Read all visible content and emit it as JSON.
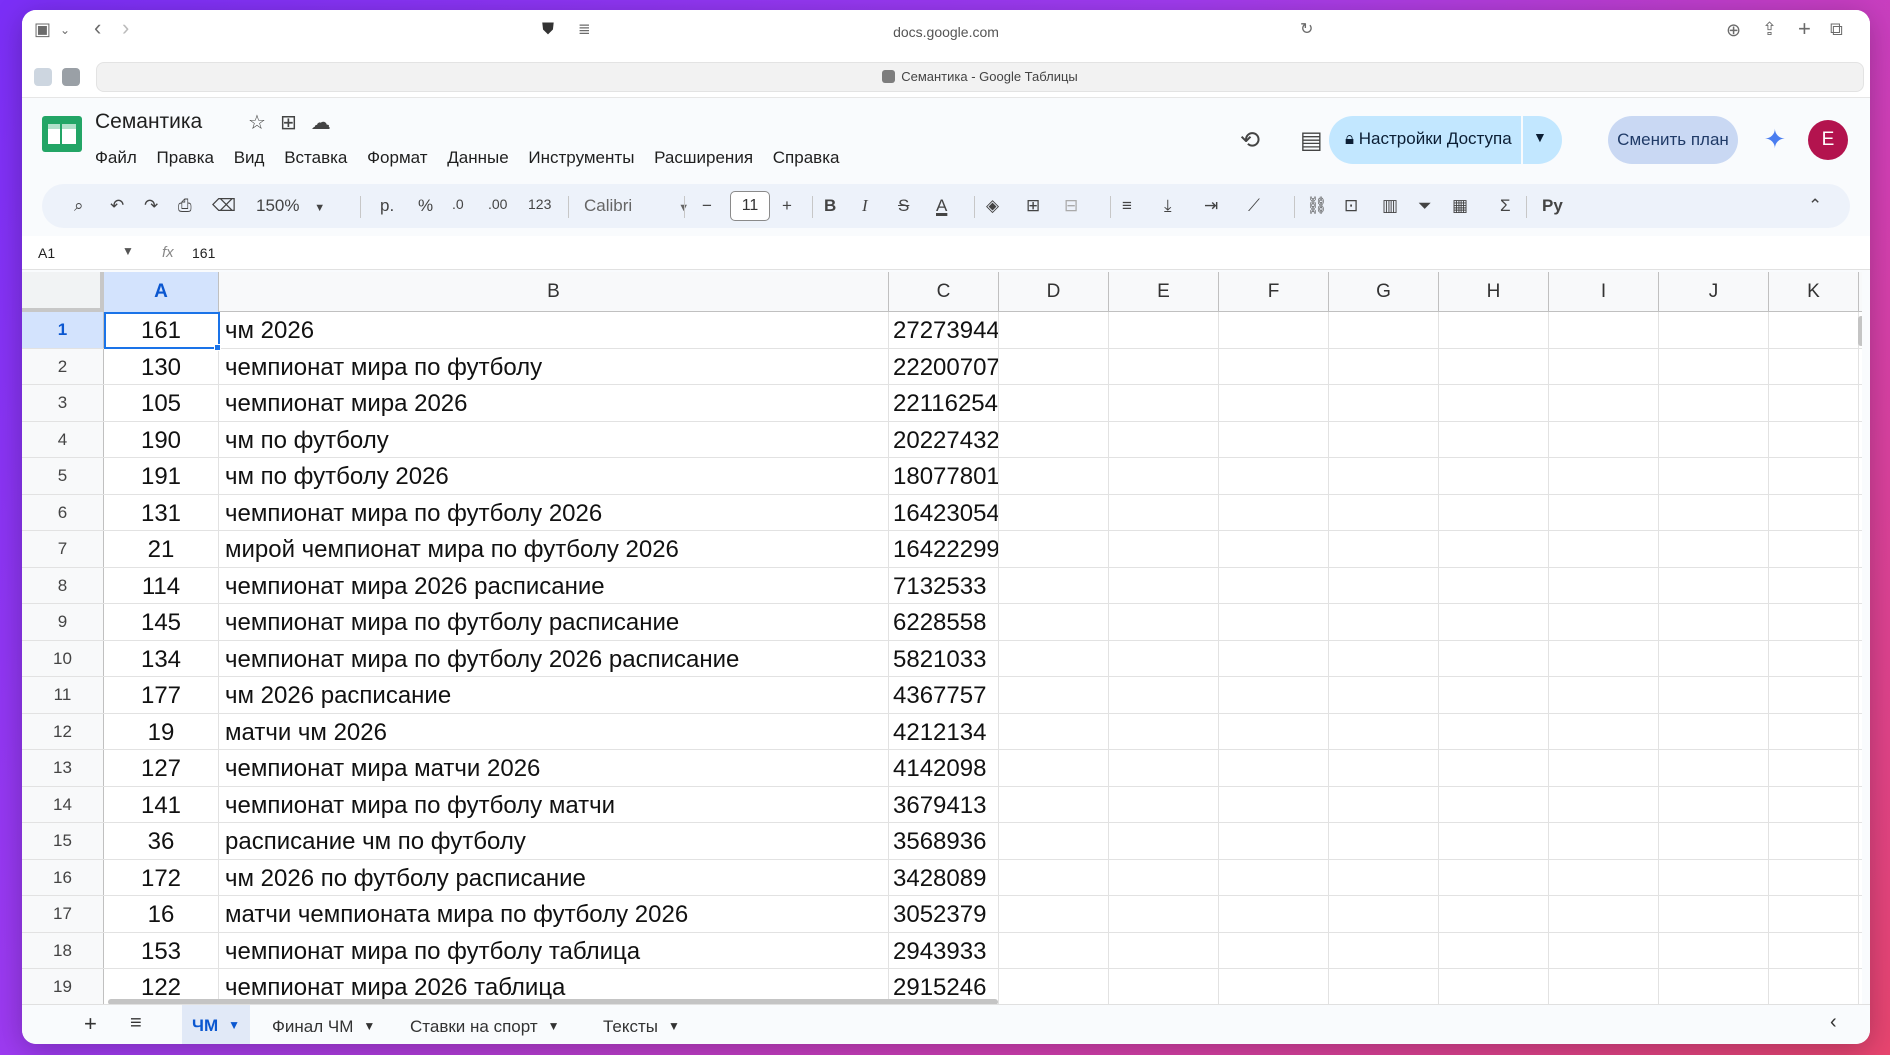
{
  "browser": {
    "url": "docs.google.com",
    "tab_title": "Семантика - Google Таблицы"
  },
  "doc": {
    "title": "Семантика",
    "menu": [
      "Файл",
      "Правка",
      "Вид",
      "Вставка",
      "Формат",
      "Данные",
      "Инструменты",
      "Расширения",
      "Справка"
    ],
    "share_label": "Настройки Доступа",
    "plan_label": "Сменить план",
    "avatar_letter": "E"
  },
  "toolbar": {
    "zoom": "150%",
    "currency": "р.",
    "percent": "%",
    "dec_decrease": ".0",
    "dec_increase": ".00",
    "format_123": "123",
    "font": "Calibri",
    "font_size": "11"
  },
  "formula_bar": {
    "cell_ref": "A1",
    "fx": "fx",
    "value": "161"
  },
  "columns": [
    "A",
    "B",
    "C",
    "D",
    "E",
    "F",
    "G",
    "H",
    "I",
    "J",
    "K"
  ],
  "rows": [
    {
      "n": "1",
      "a": "161",
      "b": "чм 2026",
      "c": "27273944"
    },
    {
      "n": "2",
      "a": "130",
      "b": "чемпионат мира по футболу",
      "c": "22200707"
    },
    {
      "n": "3",
      "a": "105",
      "b": "чемпионат мира 2026",
      "c": "22116254"
    },
    {
      "n": "4",
      "a": "190",
      "b": "чм по футболу",
      "c": "20227432"
    },
    {
      "n": "5",
      "a": "191",
      "b": "чм по футболу 2026",
      "c": "18077801"
    },
    {
      "n": "6",
      "a": "131",
      "b": "чемпионат мира по футболу 2026",
      "c": "16423054"
    },
    {
      "n": "7",
      "a": "21",
      "b": "мирой чемпионат мира по футболу 2026",
      "c": "16422299"
    },
    {
      "n": "8",
      "a": "114",
      "b": "чемпионат мира 2026 расписание",
      "c": "7132533"
    },
    {
      "n": "9",
      "a": "145",
      "b": "чемпионат мира по футболу расписание",
      "c": "6228558"
    },
    {
      "n": "10",
      "a": "134",
      "b": "чемпионат мира по футболу 2026 расписание",
      "c": "5821033"
    },
    {
      "n": "11",
      "a": "177",
      "b": "чм 2026 расписание",
      "c": "4367757"
    },
    {
      "n": "12",
      "a": "19",
      "b": "матчи чм 2026",
      "c": "4212134"
    },
    {
      "n": "13",
      "a": "127",
      "b": "чемпионат мира матчи 2026",
      "c": "4142098"
    },
    {
      "n": "14",
      "a": "141",
      "b": "чемпионат мира по футболу матчи",
      "c": "3679413"
    },
    {
      "n": "15",
      "a": "36",
      "b": "расписание чм по футболу",
      "c": "3568936"
    },
    {
      "n": "16",
      "a": "172",
      "b": "чм 2026 по футболу расписание",
      "c": "3428089"
    },
    {
      "n": "17",
      "a": "16",
      "b": "матчи чемпионата мира по футболу 2026",
      "c": "3052379"
    },
    {
      "n": "18",
      "a": "153",
      "b": "чемпионат мира по футболу таблица",
      "c": "2943933"
    },
    {
      "n": "19",
      "a": "122",
      "b": "чемпионат мира 2026 таблица",
      "c": "2915246"
    }
  ],
  "sheet_tabs": [
    "ЧМ",
    "Финал ЧМ",
    "Ставки на спорт",
    "Тексты"
  ],
  "colors": {
    "accent": "#0b57d0",
    "share_bg": "#c2e7ff",
    "avatar_bg": "#b3134e"
  }
}
